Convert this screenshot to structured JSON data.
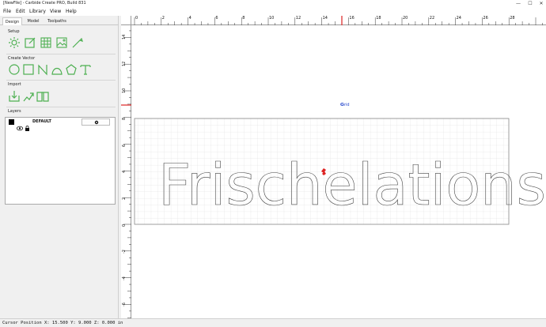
{
  "window": {
    "title": "[NewFile] - Carbide Create PRO, Build 831",
    "minimize": "—",
    "maximize": "☐",
    "close": "✕"
  },
  "menu": [
    {
      "label": "File"
    },
    {
      "label": "Edit"
    },
    {
      "label": "Library"
    },
    {
      "label": "View"
    },
    {
      "label": "Help"
    }
  ],
  "sidebar": {
    "tabs": [
      {
        "label": "Design"
      },
      {
        "label": "Model"
      },
      {
        "label": "Toolpaths"
      }
    ],
    "sections": {
      "setup": "Setup",
      "create_vector": "Create Vector",
      "import": "Import",
      "layers": "Layers"
    },
    "layer": {
      "name": "DEFAULT",
      "color": "#000000"
    }
  },
  "ruler": {
    "top_labels": [
      "0",
      "2",
      "4",
      "6",
      "8",
      "10",
      "12",
      "14",
      "16",
      "18",
      "20",
      "22",
      "24",
      "26",
      "28"
    ],
    "left_labels": [
      "14",
      "12",
      "10",
      "8",
      "6",
      "4",
      "2",
      "0",
      "-2",
      "-4",
      "-6",
      "-8"
    ]
  },
  "canvas": {
    "grid_label": "Grid",
    "text_object": "Frischelations"
  },
  "status": {
    "text": "Cursor Position X: 15.500 Y: 9.000 Z: 0.000 in"
  },
  "colors": {
    "accent_green": "#4caf50",
    "cursor_red": "#dd2222",
    "grid_blue": "#2244cc"
  }
}
